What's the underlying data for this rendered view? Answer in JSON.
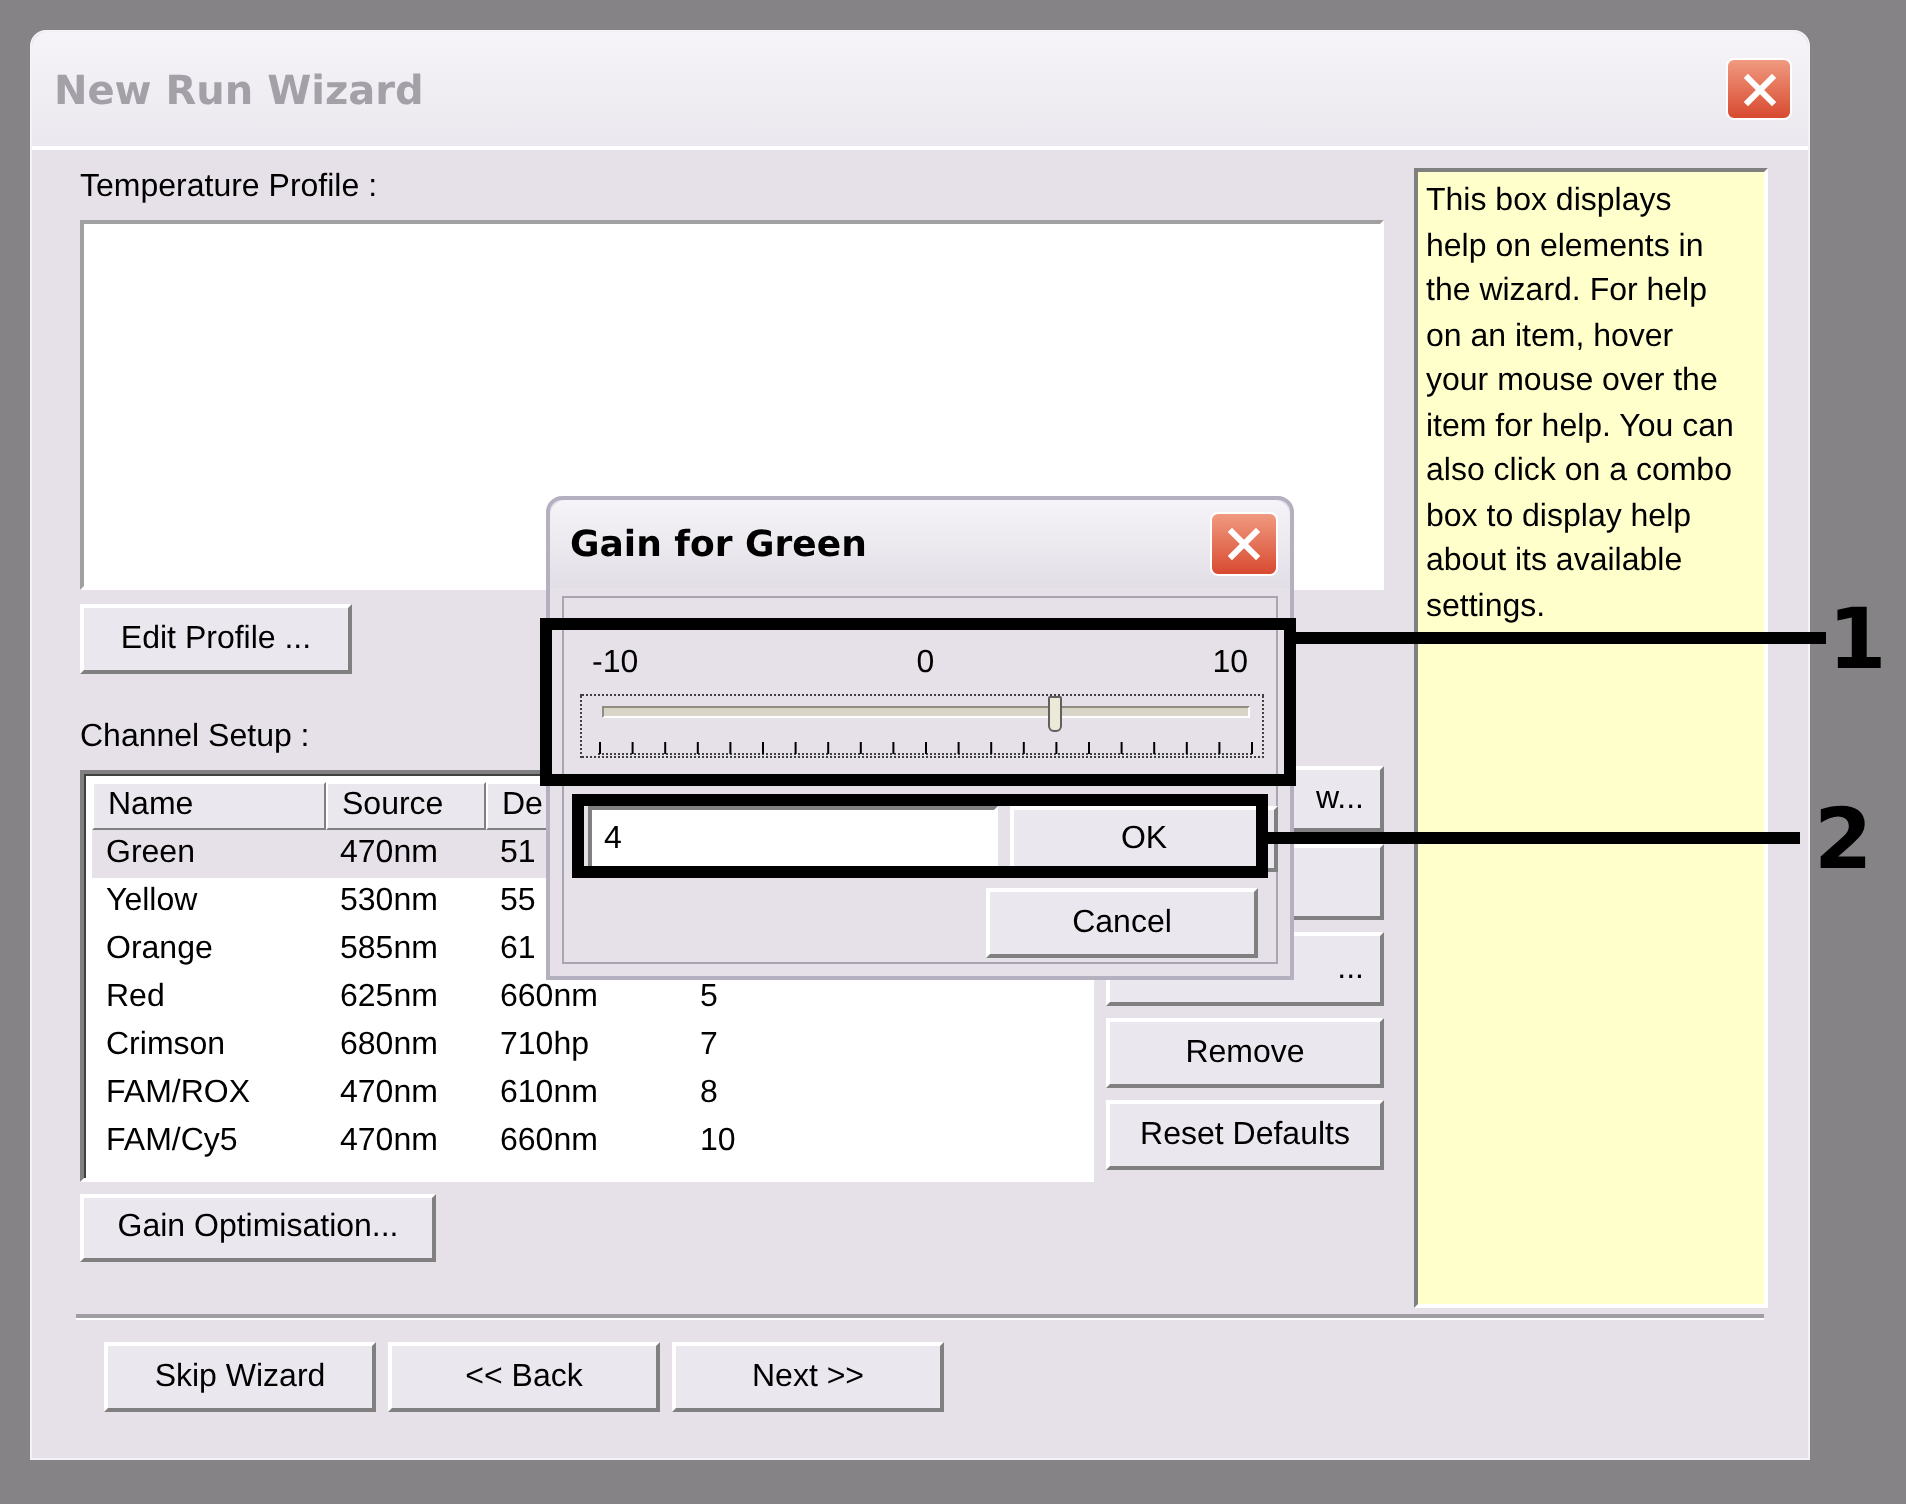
{
  "window": {
    "title": "New Run Wizard",
    "active": false
  },
  "temperature_profile": {
    "label": "Temperature Profile :"
  },
  "edit_profile_button": "Edit Profile ...",
  "channel_setup": {
    "label": "Channel Setup :",
    "columns": [
      "Name",
      "Source",
      "De"
    ],
    "rows": [
      {
        "cells": [
          "Green",
          "470nm",
          "51"
        ],
        "selected": true
      },
      {
        "cells": [
          "Yellow",
          "530nm",
          "55"
        ],
        "selected": false
      },
      {
        "cells": [
          "Orange",
          "585nm",
          "61"
        ],
        "selected": false
      },
      {
        "cells": [
          "Red",
          "625nm",
          "660nm",
          "5"
        ],
        "selected": false
      },
      {
        "cells": [
          "Crimson",
          "680nm",
          "710hp",
          "7"
        ],
        "selected": false
      },
      {
        "cells": [
          "FAM/ROX",
          "470nm",
          "610nm",
          "8"
        ],
        "selected": false
      },
      {
        "cells": [
          "FAM/Cy5",
          "470nm",
          "660nm",
          "10"
        ],
        "selected": false
      }
    ],
    "buttons": [
      {
        "kind": "partial",
        "label": "w..."
      },
      {
        "kind": "blank"
      },
      {
        "kind": "partial",
        "label": "..."
      },
      {
        "kind": "full",
        "label": "Remove"
      },
      {
        "kind": "full",
        "label": "Reset Defaults"
      }
    ]
  },
  "gain_optimisation_button": "Gain Optimisation...",
  "help_text": "This box displays help on elements in the wizard. For help on an item, hover your mouse over the item for help. You can also click on a combo box to display help about its available settings.",
  "footer_buttons": [
    "Skip Wizard",
    "<< Back",
    "Next >>"
  ],
  "dialog": {
    "title": "Gain for Green",
    "slider": {
      "labels": [
        "-10",
        "0",
        "10"
      ],
      "level": 0.7
    },
    "value": "4",
    "buttons": [
      "OK",
      "Cancel"
    ]
  },
  "callouts": [
    {
      "number": "1"
    },
    {
      "number": "2"
    }
  ]
}
